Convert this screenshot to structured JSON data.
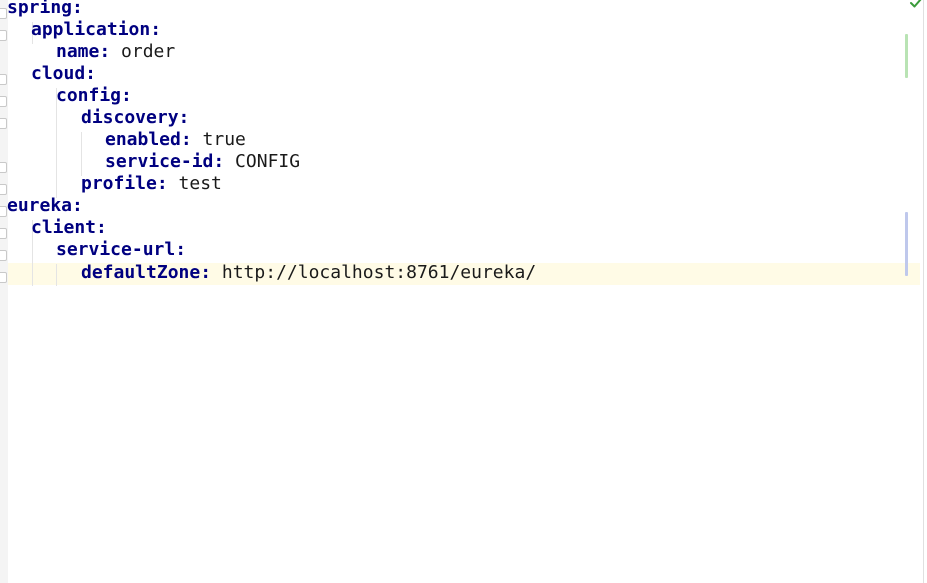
{
  "editor": {
    "lines": [
      {
        "key": "spring:",
        "value": ""
      },
      {
        "key": "application:",
        "value": ""
      },
      {
        "key": "name:",
        "value": " order"
      },
      {
        "key": "cloud:",
        "value": ""
      },
      {
        "key": "config:",
        "value": ""
      },
      {
        "key": "discovery:",
        "value": ""
      },
      {
        "key": "enabled:",
        "value": " true"
      },
      {
        "key": "service-id:",
        "value": " CONFIG"
      },
      {
        "key": "profile:",
        "value": " test"
      },
      {
        "key": "eureka:",
        "value": ""
      },
      {
        "key": "client:",
        "value": ""
      },
      {
        "key": "service-url:",
        "value": ""
      },
      {
        "key": "defaultZone:",
        "value": " http://localhost:8761/eureka/"
      }
    ],
    "status_icon": "check-icon",
    "colors": {
      "key": "#000080",
      "value": "#1a1a1a",
      "current_line": "#fffbe6",
      "check": "#3a9b3a"
    }
  }
}
